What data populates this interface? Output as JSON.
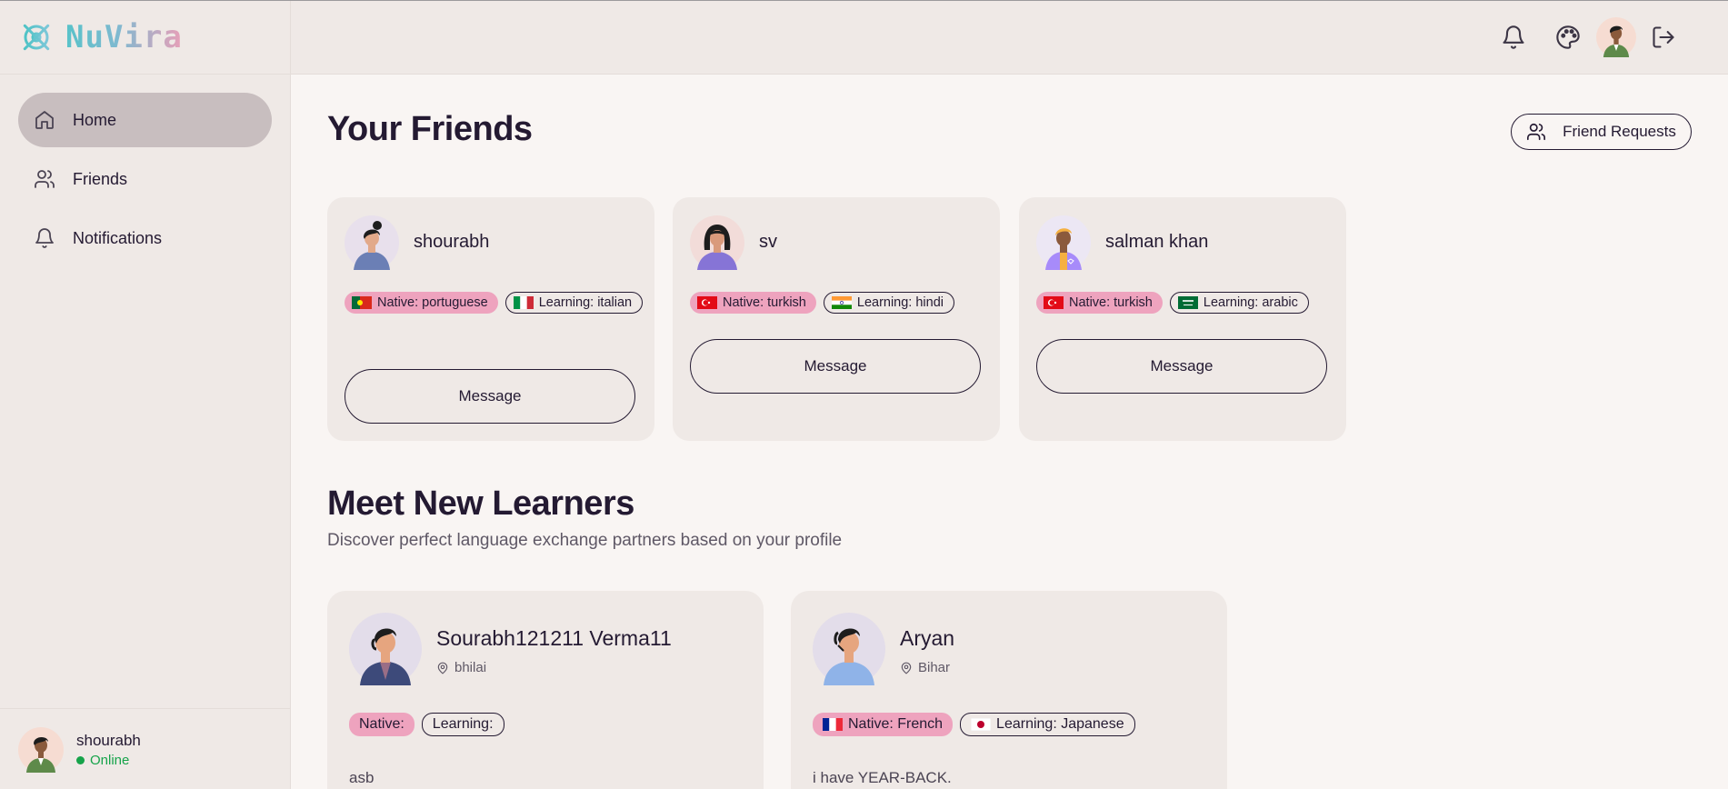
{
  "brand": {
    "name": "NuVira"
  },
  "sidebar": {
    "items": [
      {
        "label": "Home",
        "icon": "home-icon",
        "active": true
      },
      {
        "label": "Friends",
        "icon": "users-icon",
        "active": false
      },
      {
        "label": "Notifications",
        "icon": "bell-icon",
        "active": false
      }
    ],
    "user": {
      "name": "shourabh",
      "status": "Online"
    }
  },
  "topbar": {
    "icons": [
      "bell-icon",
      "palette-icon",
      "avatar",
      "logout-icon"
    ]
  },
  "friends_section": {
    "title": "Your Friends",
    "requests_label": "Friend Requests",
    "friends": [
      {
        "name": "shourabh",
        "native": "Native: portuguese",
        "learning": "Learning: italian",
        "native_flag": "portugal",
        "learning_flag": "italy",
        "message": "Message"
      },
      {
        "name": "sv",
        "native": "Native: turkish",
        "learning": "Learning: hindi",
        "native_flag": "turkey",
        "learning_flag": "india",
        "message": "Message"
      },
      {
        "name": "salman khan",
        "native": "Native: turkish",
        "learning": "Learning: arabic",
        "native_flag": "turkey",
        "learning_flag": "saudi",
        "message": "Message"
      }
    ]
  },
  "learners_section": {
    "title": "Meet New Learners",
    "subtitle": "Discover perfect language exchange partners based on your profile",
    "learners": [
      {
        "name": "Sourabh121211 Verma11",
        "location": "bhilai",
        "native": "Native:",
        "learning": "Learning:",
        "bio": "asb"
      },
      {
        "name": "Aryan",
        "location": "Bihar",
        "native": "Native: French",
        "learning": "Learning: Japanese",
        "native_flag": "france",
        "learning_flag": "japan",
        "bio": "i have YEAR-BACK."
      }
    ]
  },
  "colors": {
    "sidebar_bg": "#efe9e6",
    "page_bg": "#f9f5f3",
    "active_nav": "#c8bebf",
    "native_tag": "#eea3be",
    "online": "#16a34a",
    "text": "#241a32"
  }
}
